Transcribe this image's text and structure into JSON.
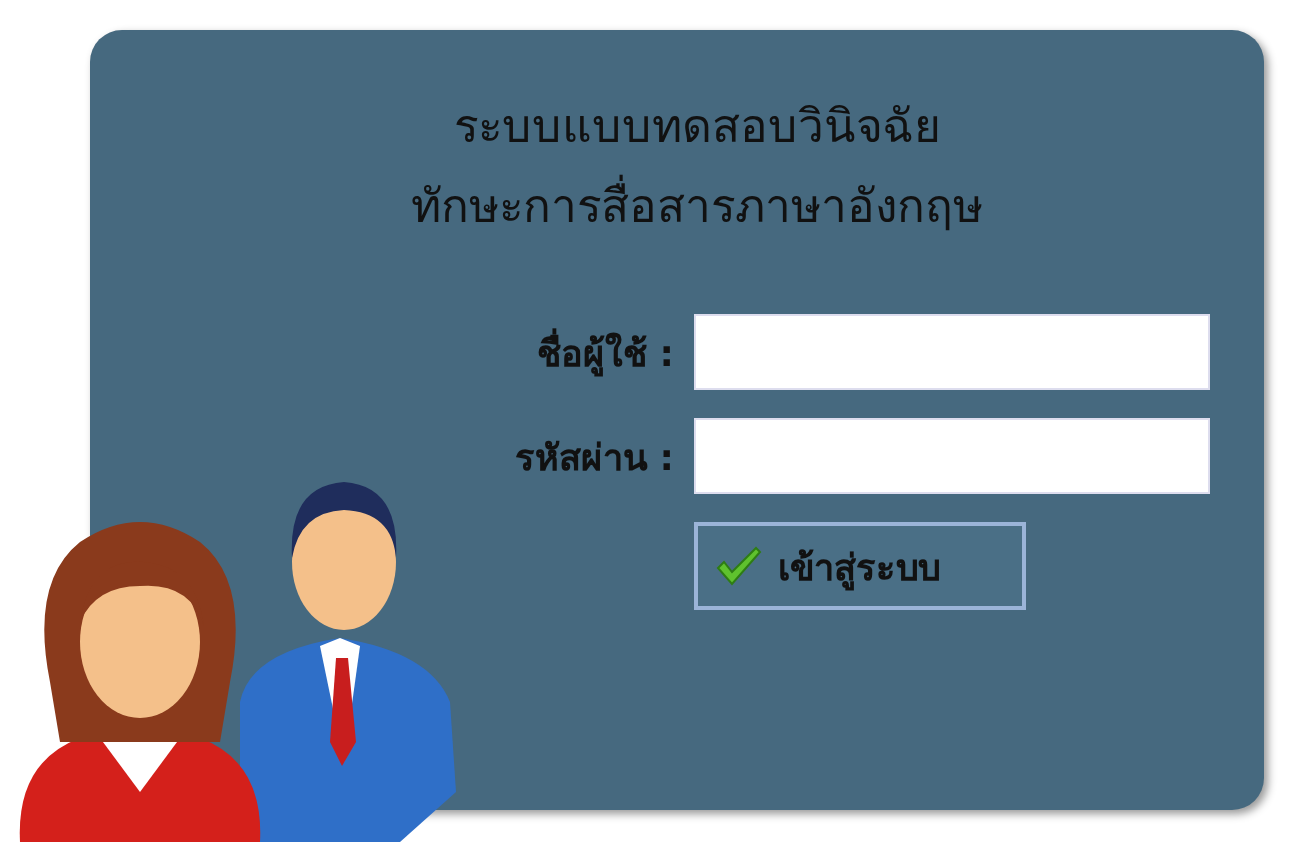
{
  "title_lines": [
    "ระบบแบบทดสอบวินิจฉัย",
    "ทักษะการสื่อสารภาษาอังกฤษ"
  ],
  "fields": [
    {
      "label": "ชื่อผู้ใช้ :"
    },
    {
      "label": "รหัสผ่าน :"
    }
  ],
  "login_button": {
    "label": "เข้าสู่ระบบ"
  }
}
